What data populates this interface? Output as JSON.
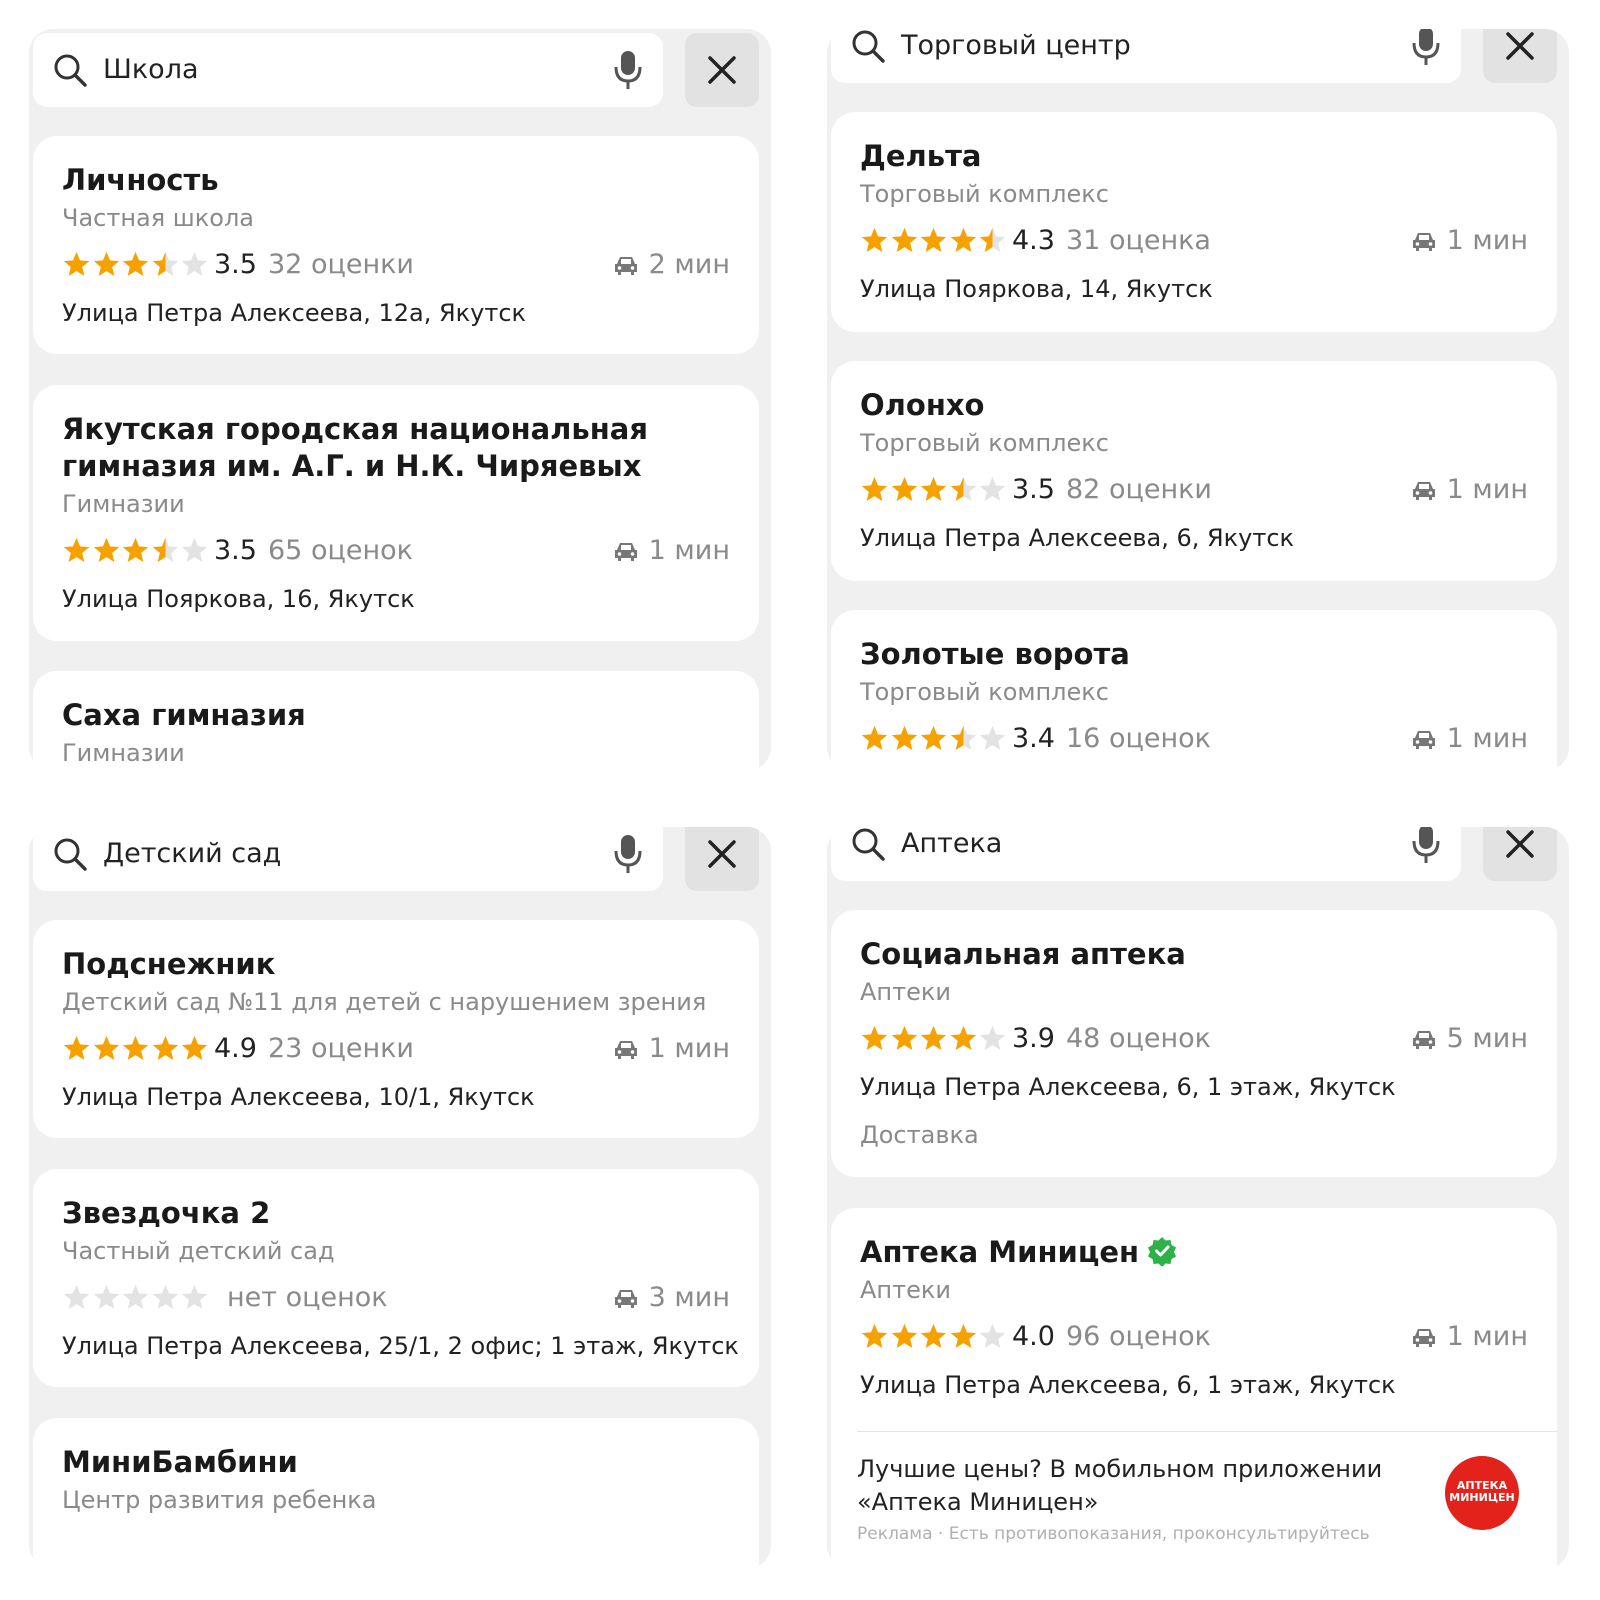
{
  "colors": {
    "star": "#f5a100",
    "star_empty": "#e3e3e3",
    "verified": "#2db24a",
    "ad_logo": "#e3231b"
  },
  "panels": [
    {
      "search": {
        "query": "Школа",
        "icon": "search-icon",
        "mic_icon": "microphone-icon",
        "close_icon": "close-icon"
      },
      "results": [
        {
          "title": "Личность",
          "category": "Частная школа",
          "rating": "3.5",
          "stars": 3.5,
          "count": "32 оценки",
          "eta": "2 мин",
          "address": "Улица Петра Алексеева, 12а, Якутск"
        },
        {
          "title": "Якутская городская национальная гимназия им. А.Г. и Н.К. Чиряевых",
          "category": "Гимназии",
          "rating": "3.5",
          "stars": 3.5,
          "count": "65 оценок",
          "eta": "1 мин",
          "address": "Улица Пояркова, 16, Якутск"
        },
        {
          "title": "Саха гимназия",
          "category": "Гимназии"
        }
      ]
    },
    {
      "search": {
        "query": "Торговый центр",
        "icon": "search-icon",
        "mic_icon": "microphone-icon",
        "close_icon": "close-icon"
      },
      "results": [
        {
          "title": "Дельта",
          "category": "Торговый комплекс",
          "rating": "4.3",
          "stars": 4.5,
          "count": "31 оценка",
          "eta": "1 мин",
          "address": "Улица Пояркова, 14, Якутск"
        },
        {
          "title": "Олонхо",
          "category": "Торговый комплекс",
          "rating": "3.5",
          "stars": 3.5,
          "count": "82 оценки",
          "eta": "1 мин",
          "address": "Улица Петра Алексеева, 6, Якутск"
        },
        {
          "title": "Золотые ворота",
          "category": "Торговый комплекс",
          "rating": "3.4",
          "stars": 3.5,
          "count": "16 оценок",
          "eta": "1 мин"
        }
      ]
    },
    {
      "search": {
        "query": "Детский сад",
        "icon": "search-icon",
        "mic_icon": "microphone-icon",
        "close_icon": "close-icon"
      },
      "results": [
        {
          "title": "Подснежник",
          "category": "Детский сад №11 для детей с нарушением зрения",
          "rating": "4.9",
          "stars": 5,
          "count": "23 оценки",
          "eta": "1 мин",
          "address": "Улица Петра Алексеева, 10/1, Якутск"
        },
        {
          "title": "Звездочка 2",
          "category": "Частный детский сад",
          "stars": 0,
          "no_rating": "нет оценок",
          "eta": "3 мин",
          "address": "Улица Петра Алексеева, 25/1, 2 офис; 1 этаж, Якутск"
        },
        {
          "title": "МиниБамбини",
          "category": "Центр развития ребенка"
        }
      ]
    },
    {
      "search": {
        "query": "Аптека",
        "icon": "search-icon",
        "mic_icon": "microphone-icon",
        "close_icon": "close-icon"
      },
      "results": [
        {
          "title": "Социальная аптека",
          "category": "Аптеки",
          "rating": "3.9",
          "stars": 4,
          "count": "48 оценок",
          "eta": "5 мин",
          "address": "Улица Петра Алексеева, 6, 1 этаж, Якутск",
          "extra": "Доставка"
        },
        {
          "title": "Аптека Миницен",
          "verified_icon": "verified-badge-icon",
          "category": "Аптеки",
          "rating": "4.0",
          "stars": 4,
          "count": "96 оценок",
          "eta": "1 мин",
          "address": "Улица Петра Алексеева, 6, 1 этаж, Якутск",
          "ad": {
            "text": "Лучшие цены? В мобильном приложении «Аптека Миницен»",
            "note": "Реклама · Есть противопоказания, проконсультируйтесь",
            "logo_text": "АПТЕКА МИНИЦЕН"
          }
        }
      ]
    }
  ]
}
